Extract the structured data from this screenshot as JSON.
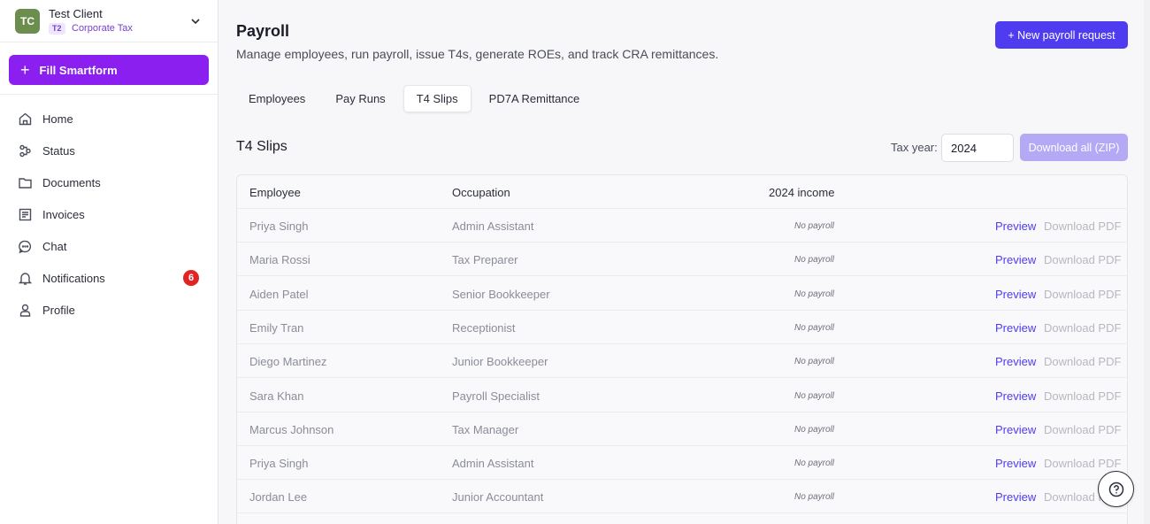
{
  "client": {
    "initials": "TC",
    "name": "Test Client",
    "badge": "T2",
    "type": "Corporate Tax"
  },
  "smartform": {
    "label": "Fill Smartform"
  },
  "nav": [
    {
      "label": "Home",
      "icon": "home-icon"
    },
    {
      "label": "Status",
      "icon": "status-icon"
    },
    {
      "label": "Documents",
      "icon": "folder-icon"
    },
    {
      "label": "Invoices",
      "icon": "invoice-icon"
    },
    {
      "label": "Chat",
      "icon": "chat-icon"
    },
    {
      "label": "Notifications",
      "icon": "bell-icon",
      "badge": "6"
    },
    {
      "label": "Profile",
      "icon": "user-icon"
    }
  ],
  "header": {
    "title": "Payroll",
    "subtitle": "Manage employees, run payroll, issue T4s, generate ROEs, and track CRA remittances.",
    "new_button": "+ New payroll request"
  },
  "tabs": [
    {
      "label": "Employees",
      "active": false
    },
    {
      "label": "Pay Runs",
      "active": false
    },
    {
      "label": "T4 Slips",
      "active": true
    },
    {
      "label": "PD7A Remittance",
      "active": false
    }
  ],
  "section": {
    "title": "T4 Slips",
    "tax_year_label": "Tax year:",
    "tax_year_value": "2024",
    "download_all": "Download all (ZIP)"
  },
  "table": {
    "columns": {
      "employee": "Employee",
      "occupation": "Occupation",
      "income": "2024 income"
    },
    "rows": [
      {
        "employee": "Priya Singh",
        "occupation": "Admin Assistant",
        "income": "No payroll",
        "preview": "Preview",
        "download": "Download PDF"
      },
      {
        "employee": "Maria Rossi",
        "occupation": "Tax Preparer",
        "income": "No payroll",
        "preview": "Preview",
        "download": "Download PDF"
      },
      {
        "employee": "Aiden Patel",
        "occupation": "Senior Bookkeeper",
        "income": "No payroll",
        "preview": "Preview",
        "download": "Download PDF"
      },
      {
        "employee": "Emily Tran",
        "occupation": "Receptionist",
        "income": "No payroll",
        "preview": "Preview",
        "download": "Download PDF"
      },
      {
        "employee": "Diego Martinez",
        "occupation": "Junior Bookkeeper",
        "income": "No payroll",
        "preview": "Preview",
        "download": "Download PDF"
      },
      {
        "employee": "Sara Khan",
        "occupation": "Payroll Specialist",
        "income": "No payroll",
        "preview": "Preview",
        "download": "Download PDF"
      },
      {
        "employee": "Marcus Johnson",
        "occupation": "Tax Manager",
        "income": "No payroll",
        "preview": "Preview",
        "download": "Download PDF"
      },
      {
        "employee": "Priya Singh",
        "occupation": "Admin Assistant",
        "income": "No payroll",
        "preview": "Preview",
        "download": "Download PDF"
      },
      {
        "employee": "Jordan Lee",
        "occupation": "Junior Accountant",
        "income": "No payroll",
        "preview": "Preview",
        "download": "Download PDF"
      }
    ]
  },
  "colors": {
    "accent": "#4f3cf0",
    "smartform": "#8a1ff0",
    "badge": "#e02424",
    "avatar": "#6b8e4e"
  }
}
